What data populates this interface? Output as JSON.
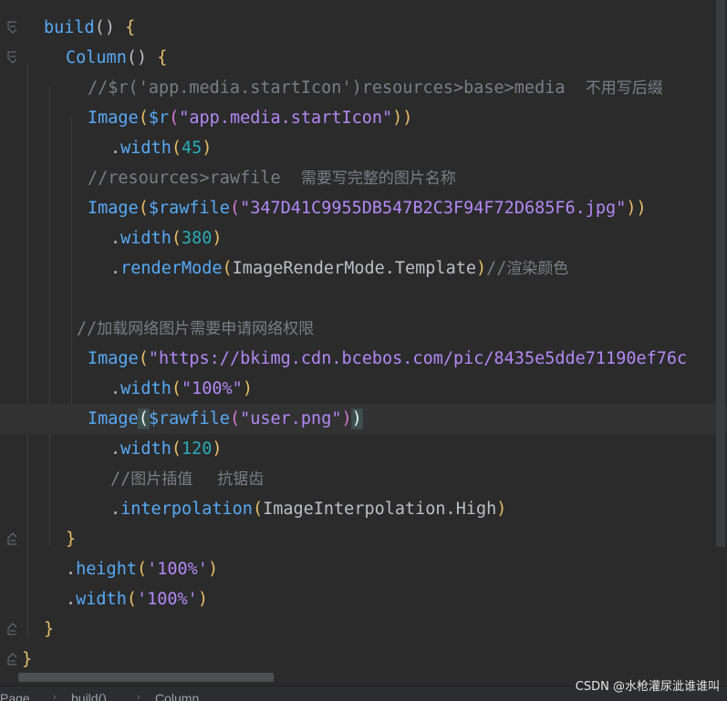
{
  "code": {
    "lines": [
      {
        "tokens": [
          {
            "t": "build",
            "c": "mth"
          },
          {
            "t": "() ",
            "c": "plain"
          },
          {
            "t": "{",
            "c": "paren-y"
          }
        ]
      },
      {
        "tokens": [
          {
            "t": "Column",
            "c": "mth"
          },
          {
            "t": "() ",
            "c": "plain"
          },
          {
            "t": "{",
            "c": "paren-y"
          }
        ]
      },
      {
        "tokens": [
          {
            "t": "//$r('app.media.startIcon')resources>base>media  ",
            "c": "cmt"
          },
          {
            "t": "不用写后缀",
            "c": "cmtcn"
          }
        ]
      },
      {
        "tokens": [
          {
            "t": "Image",
            "c": "mth"
          },
          {
            "t": "(",
            "c": "paren-y"
          },
          {
            "t": "$r",
            "c": "mth"
          },
          {
            "t": "(",
            "c": "paren-p"
          },
          {
            "t": "\"app.media.startIcon\"",
            "c": "str"
          },
          {
            "t": "))",
            "c": "paren-y"
          }
        ]
      },
      {
        "tokens": [
          {
            "t": ".",
            "c": "plain"
          },
          {
            "t": "width",
            "c": "mth"
          },
          {
            "t": "(",
            "c": "paren-y"
          },
          {
            "t": "45",
            "c": "num"
          },
          {
            "t": ")",
            "c": "paren-y"
          }
        ]
      },
      {
        "tokens": [
          {
            "t": "//resources>rawfile  ",
            "c": "cmt"
          },
          {
            "t": "需要写完整的图片名称",
            "c": "cmtcn"
          }
        ]
      },
      {
        "tokens": [
          {
            "t": "Image",
            "c": "mth"
          },
          {
            "t": "(",
            "c": "paren-y"
          },
          {
            "t": "$rawfile",
            "c": "mth"
          },
          {
            "t": "(",
            "c": "paren-p"
          },
          {
            "t": "\"347D41C9955DB547B2C3F94F72D685F6.jpg\"",
            "c": "str"
          },
          {
            "t": "))",
            "c": "paren-y"
          }
        ]
      },
      {
        "tokens": [
          {
            "t": ".",
            "c": "plain"
          },
          {
            "t": "width",
            "c": "mth"
          },
          {
            "t": "(",
            "c": "paren-y"
          },
          {
            "t": "380",
            "c": "num"
          },
          {
            "t": ")",
            "c": "paren-y"
          }
        ]
      },
      {
        "tokens": [
          {
            "t": ".",
            "c": "plain"
          },
          {
            "t": "renderMode",
            "c": "mth"
          },
          {
            "t": "(",
            "c": "paren-y"
          },
          {
            "t": "ImageRenderMode.Template",
            "c": "plain"
          },
          {
            "t": ")",
            "c": "paren-y"
          },
          {
            "t": "//",
            "c": "cmt"
          },
          {
            "t": "渲染颜色",
            "c": "cmtcn"
          }
        ]
      },
      {
        "tokens": []
      },
      {
        "tokens": [
          {
            "t": "//",
            "c": "cmt"
          },
          {
            "t": "加载网络图片需要申请网络权限",
            "c": "cmtcn"
          }
        ]
      },
      {
        "tokens": [
          {
            "t": "Image",
            "c": "mth"
          },
          {
            "t": "(",
            "c": "paren-y"
          },
          {
            "t": "\"https://bkimg.cdn.bcebos.com/pic/8435e5dde71190ef76c",
            "c": "str"
          }
        ]
      },
      {
        "tokens": [
          {
            "t": ".",
            "c": "plain"
          },
          {
            "t": "width",
            "c": "mth"
          },
          {
            "t": "(",
            "c": "paren-y"
          },
          {
            "t": "\"100%\"",
            "c": "str"
          },
          {
            "t": ")",
            "c": "paren-y"
          }
        ]
      },
      {
        "tokens": [
          {
            "t": "Image",
            "c": "mth"
          },
          {
            "t": "(",
            "c": "match"
          },
          {
            "t": "$rawfile",
            "c": "mth"
          },
          {
            "t": "(",
            "c": "paren-p"
          },
          {
            "t": "\"user.png\"",
            "c": "str"
          },
          {
            "t": ")",
            "c": "paren-p"
          },
          {
            "t": ")",
            "c": "match"
          }
        ]
      },
      {
        "tokens": [
          {
            "t": ".",
            "c": "plain"
          },
          {
            "t": "width",
            "c": "mth"
          },
          {
            "t": "(",
            "c": "paren-y"
          },
          {
            "t": "120",
            "c": "num"
          },
          {
            "t": ")",
            "c": "paren-y"
          }
        ]
      },
      {
        "tokens": [
          {
            "t": "//",
            "c": "cmt"
          },
          {
            "t": "图片插值     抗锯齿",
            "c": "cmtcn"
          }
        ]
      },
      {
        "tokens": [
          {
            "t": ".",
            "c": "plain"
          },
          {
            "t": "interpolation",
            "c": "mth"
          },
          {
            "t": "(",
            "c": "paren-y"
          },
          {
            "t": "ImageInterpolation.High",
            "c": "plain"
          },
          {
            "t": ")",
            "c": "paren-y"
          }
        ]
      },
      {
        "tokens": [
          {
            "t": "}",
            "c": "paren-y"
          }
        ]
      },
      {
        "tokens": [
          {
            "t": ".",
            "c": "plain"
          },
          {
            "t": "height",
            "c": "mth"
          },
          {
            "t": "(",
            "c": "paren-y"
          },
          {
            "t": "'100%'",
            "c": "str"
          },
          {
            "t": ")",
            "c": "paren-y"
          }
        ]
      },
      {
        "tokens": [
          {
            "t": ".",
            "c": "plain"
          },
          {
            "t": "width",
            "c": "mth"
          },
          {
            "t": "(",
            "c": "paren-y"
          },
          {
            "t": "'100%'",
            "c": "str"
          },
          {
            "t": ")",
            "c": "paren-y"
          }
        ]
      },
      {
        "tokens": [
          {
            "t": "}",
            "c": "paren-y"
          }
        ]
      },
      {
        "tokens": [
          {
            "t": "}",
            "c": "paren-y"
          }
        ]
      }
    ]
  },
  "breadcrumb": {
    "items": [
      "Page",
      "build()",
      "Column"
    ]
  },
  "watermark": "CSDN @水枪灌尿泚谁谁叫",
  "colors": {
    "background": "#2b2b2b",
    "current_line": "#323232",
    "comment": "#7a7e85",
    "string": "#b189f5",
    "number": "#2aacb8",
    "method": "#57aaf7",
    "brace": "#e8bf6a"
  }
}
